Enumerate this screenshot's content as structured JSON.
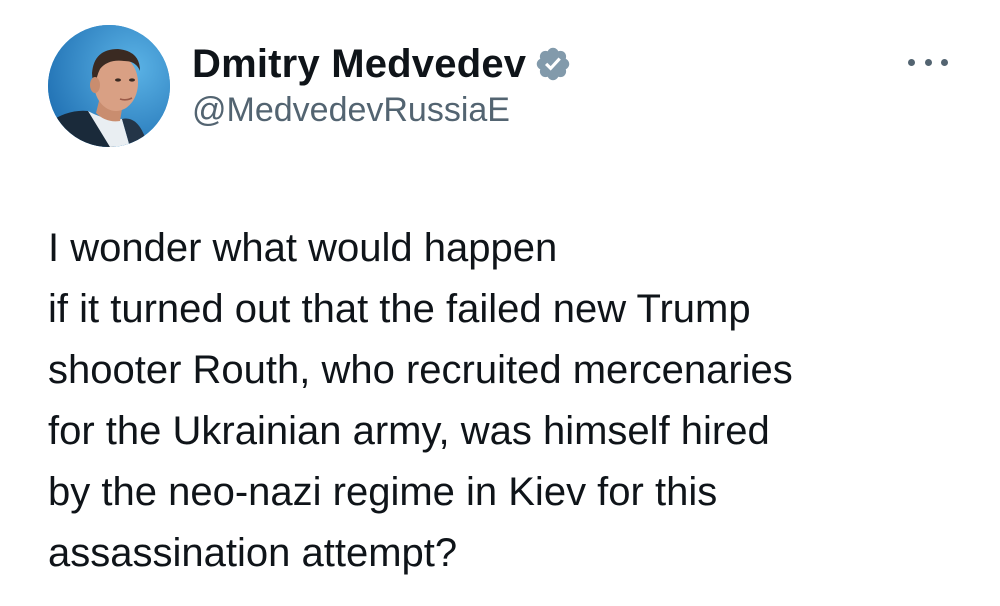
{
  "author": {
    "display_name": "Dmitry Medvedev",
    "handle": "@MedvedevRussiaE",
    "verified_icon": "verified-badge-icon",
    "verified_color": "#829aab"
  },
  "menu": {
    "icon": "more-options-icon"
  },
  "tweet": {
    "text": "I wonder what would happen\nif it turned out that the failed new Trump\nshooter Routh, who recruited mercenaries\nfor the Ukrainian army, was himself hired\nby the neo-nazi regime in Kiev for this\nassassination attempt?"
  }
}
